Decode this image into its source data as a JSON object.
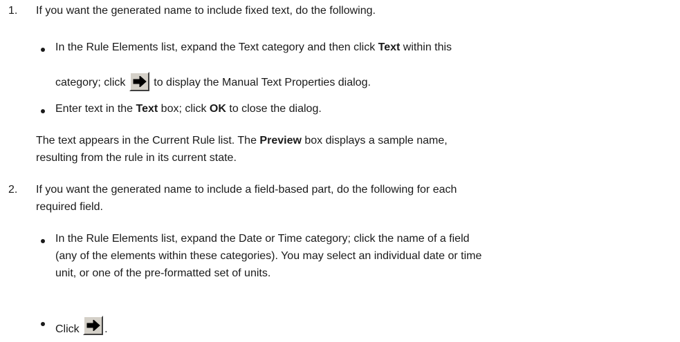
{
  "steps": [
    {
      "number": "1.",
      "intro": "If you want the generated name to include fixed text, do the following.",
      "bullets": [
        {
          "line1_before": "In the Rule Elements list, expand the Text category and then click ",
          "line1_bold": "Text",
          "line1_after": " within this",
          "line2_before": "category; click ",
          "line2_after": " to display the Manual Text Properties dialog."
        },
        {
          "t1": "Enter text in the ",
          "b1": "Text",
          "t2": " box; click ",
          "b2": "OK",
          "t3": " to close the dialog."
        }
      ],
      "after_p1_before": "The text appears in the Current Rule list. The ",
      "after_p1_bold": "Preview",
      "after_p1_after": " box displays a sample name,",
      "after_p2": "resulting from the rule in its current state."
    },
    {
      "number": "2.",
      "intro_line1": "If you want the generated name to include a field-based part, do the following for each",
      "intro_line2": "required field.",
      "bullets": [
        {
          "line1": "In the Rule Elements list, expand the Date or Time category; click the name of a field",
          "line2": "(any of the elements within these categories). You may select an individual date or time",
          "line3": "unit, or one of the pre-formatted set of units."
        },
        {
          "before": "Click ",
          "after": "."
        }
      ]
    }
  ],
  "icons": {
    "add_arrow": "right-arrow-icon"
  }
}
